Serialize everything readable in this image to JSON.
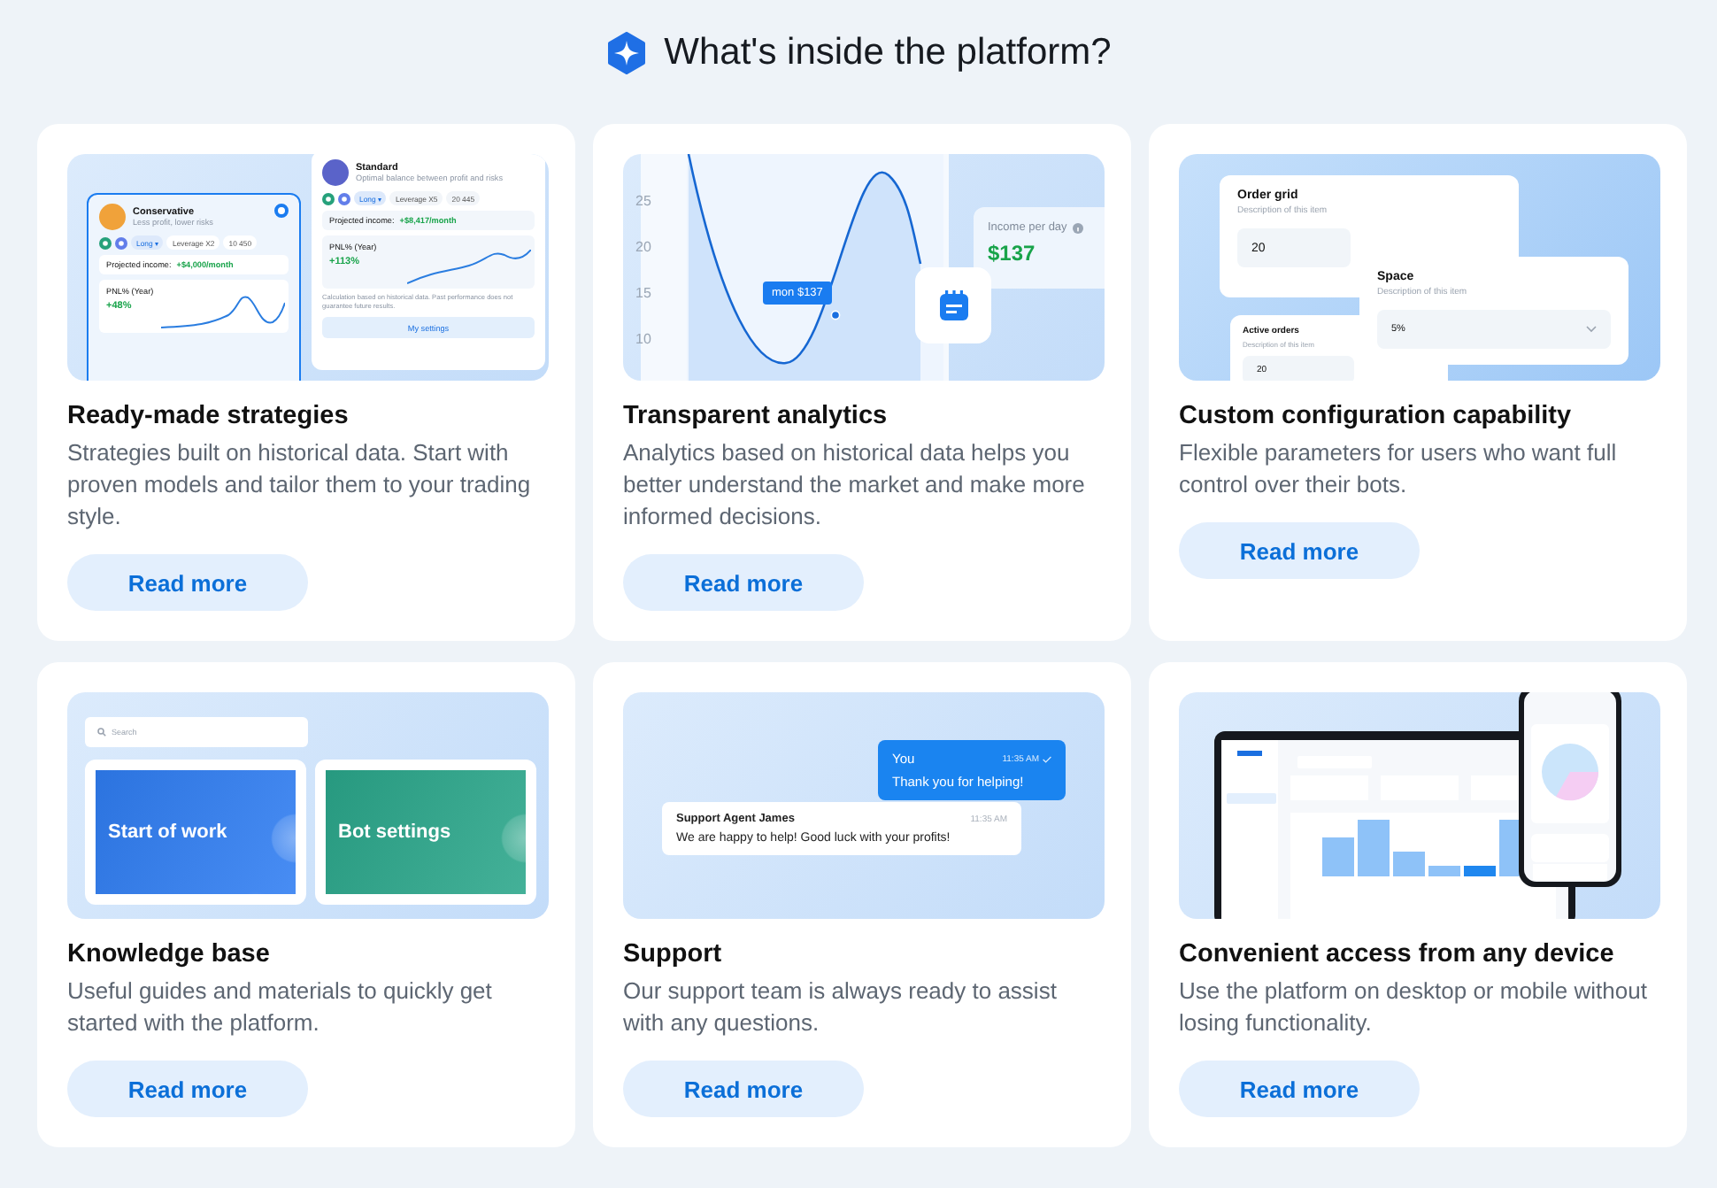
{
  "header": {
    "title": "What's inside the platform?"
  },
  "features": [
    {
      "title": "Ready-made strategies",
      "description": "Strategies built on historical data. Start with proven models and tailor them to your trading style.",
      "button": "Read more",
      "illustration": {
        "kind": "strategies",
        "strategies": [
          {
            "name": "Conservative",
            "subtitle": "Less profit, lower risks",
            "direction": "Long ▾",
            "leverage": "Leverage X2",
            "amount": "10 450",
            "income_label": "Projected income:",
            "income_value": "+$4,000/month",
            "pnl_label": "PNL% (Year)",
            "pnl_value": "+48%",
            "selected": true
          },
          {
            "name": "Standard",
            "subtitle": "Optimal balance between profit and risks",
            "direction": "Long ▾",
            "leverage": "Leverage X5",
            "amount": "20 445",
            "income_label": "Projected income:",
            "income_value": "+$8,417/month",
            "pnl_label": "PNL% (Year)",
            "pnl_value": "+113%",
            "selected": false
          }
        ],
        "disclaimer": "Calculation based on historical data. Past performance does not guarantee future results.",
        "settings_button": "My settings"
      }
    },
    {
      "title": "Transparent analytics",
      "description": "Analytics based on historical data helps you better understand the market and make more informed decisions.",
      "button": "Read more",
      "illustration": {
        "kind": "analytics",
        "y_labels": [
          "25",
          "20",
          "15",
          "10"
        ],
        "tooltip": "mon $137",
        "income_label": "Income per day",
        "income_value": "$137"
      }
    },
    {
      "title": "Custom configuration capability",
      "description": "Flexible parameters for users who want full control over their bots.",
      "button": "Read more",
      "illustration": {
        "kind": "config",
        "panels": [
          {
            "title": "Order grid",
            "description": "Description of this item",
            "value": "20"
          },
          {
            "title": "Active orders",
            "description": "Description of this item",
            "value": "20"
          },
          {
            "title": "Space",
            "description": "Description of this item",
            "value": "5%"
          }
        ]
      }
    },
    {
      "title": "Knowledge base",
      "description": "Useful guides and materials to quickly get started with the platform.",
      "button": "Read more",
      "illustration": {
        "kind": "knowledge",
        "search_placeholder": "Search",
        "topics": [
          {
            "label": "Start of work",
            "color": "#2f7df2"
          },
          {
            "label": "Bot settings",
            "color": "#2aa68a"
          }
        ]
      }
    },
    {
      "title": "Support",
      "description": "Our support team is always ready to assist with any questions.",
      "button": "Read more",
      "illustration": {
        "kind": "support",
        "messages": [
          {
            "kind": "outgoing",
            "sender": "You",
            "time": "11:35 AM",
            "text": "Thank you for helping!"
          },
          {
            "kind": "incoming",
            "sender": "Support Agent James",
            "time": "11:35 AM",
            "text": "We are happy to help! Good luck with your profits!"
          }
        ]
      }
    },
    {
      "title": "Convenient access from any device",
      "description": "Use the platform on desktop or mobile without losing functionality.",
      "button": "Read more",
      "illustration": {
        "kind": "devices"
      }
    }
  ]
}
